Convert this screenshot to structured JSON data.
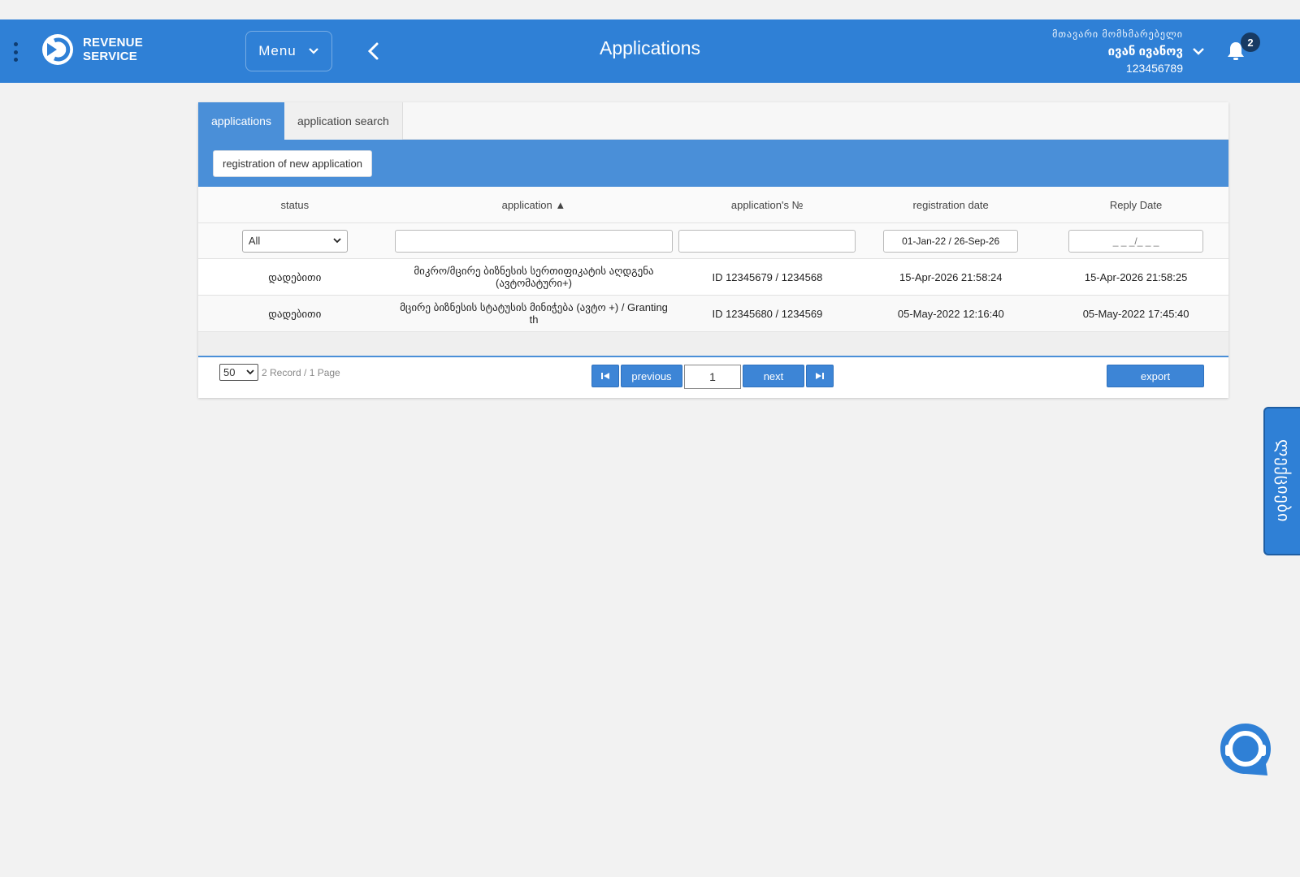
{
  "header": {
    "logo_line1": "REVENUE",
    "logo_line2": "SERVICE",
    "menu_label": "Menu",
    "title": "Applications",
    "user_role": "მთავარი მომხმარებელი",
    "user_name": "ივან ივანოვ",
    "user_id": "123456789",
    "notification_count": "2",
    "accent_color": "#2f80d6"
  },
  "tabs": [
    {
      "label": "applications",
      "active": true
    },
    {
      "label": "application search",
      "active": false
    }
  ],
  "toolbar": {
    "register_label": "registration of new application"
  },
  "table": {
    "columns": [
      "status",
      "application ▲",
      "application's №",
      "registration date",
      "Reply Date"
    ],
    "filters": {
      "status_value": "All",
      "application_value": "",
      "number_value": "",
      "registration_range": "01-Jan-22 / 26-Sep-26",
      "reply_range": "_ _ _/_ _ _"
    },
    "rows": [
      {
        "status": "დადებითი",
        "application": "მიკრო/მცირე ბიზნესის სერთიფიკატის აღდგენა (ავტომატური+)",
        "number": "ID 12345679 / 1234568",
        "registration_date": "15-Apr-2026 21:58:24",
        "reply_date": "15-Apr-2026 21:58:25"
      },
      {
        "status": "დადებითი",
        "application": "მცირე ბიზნესის სტატუსის მინიჭება (ავტო +) / Granting th",
        "number": "ID 12345680 / 1234569",
        "registration_date": "05-May-2022 12:16:40",
        "reply_date": "05-May-2022 17:45:40"
      }
    ]
  },
  "pager": {
    "page_size": "50",
    "record_info": "2 Record / 1 Page",
    "previous_label": "previous",
    "next_label": "next",
    "current_page": "1",
    "export_label": "export"
  },
  "side_tab": {
    "label": "ლექციები"
  }
}
